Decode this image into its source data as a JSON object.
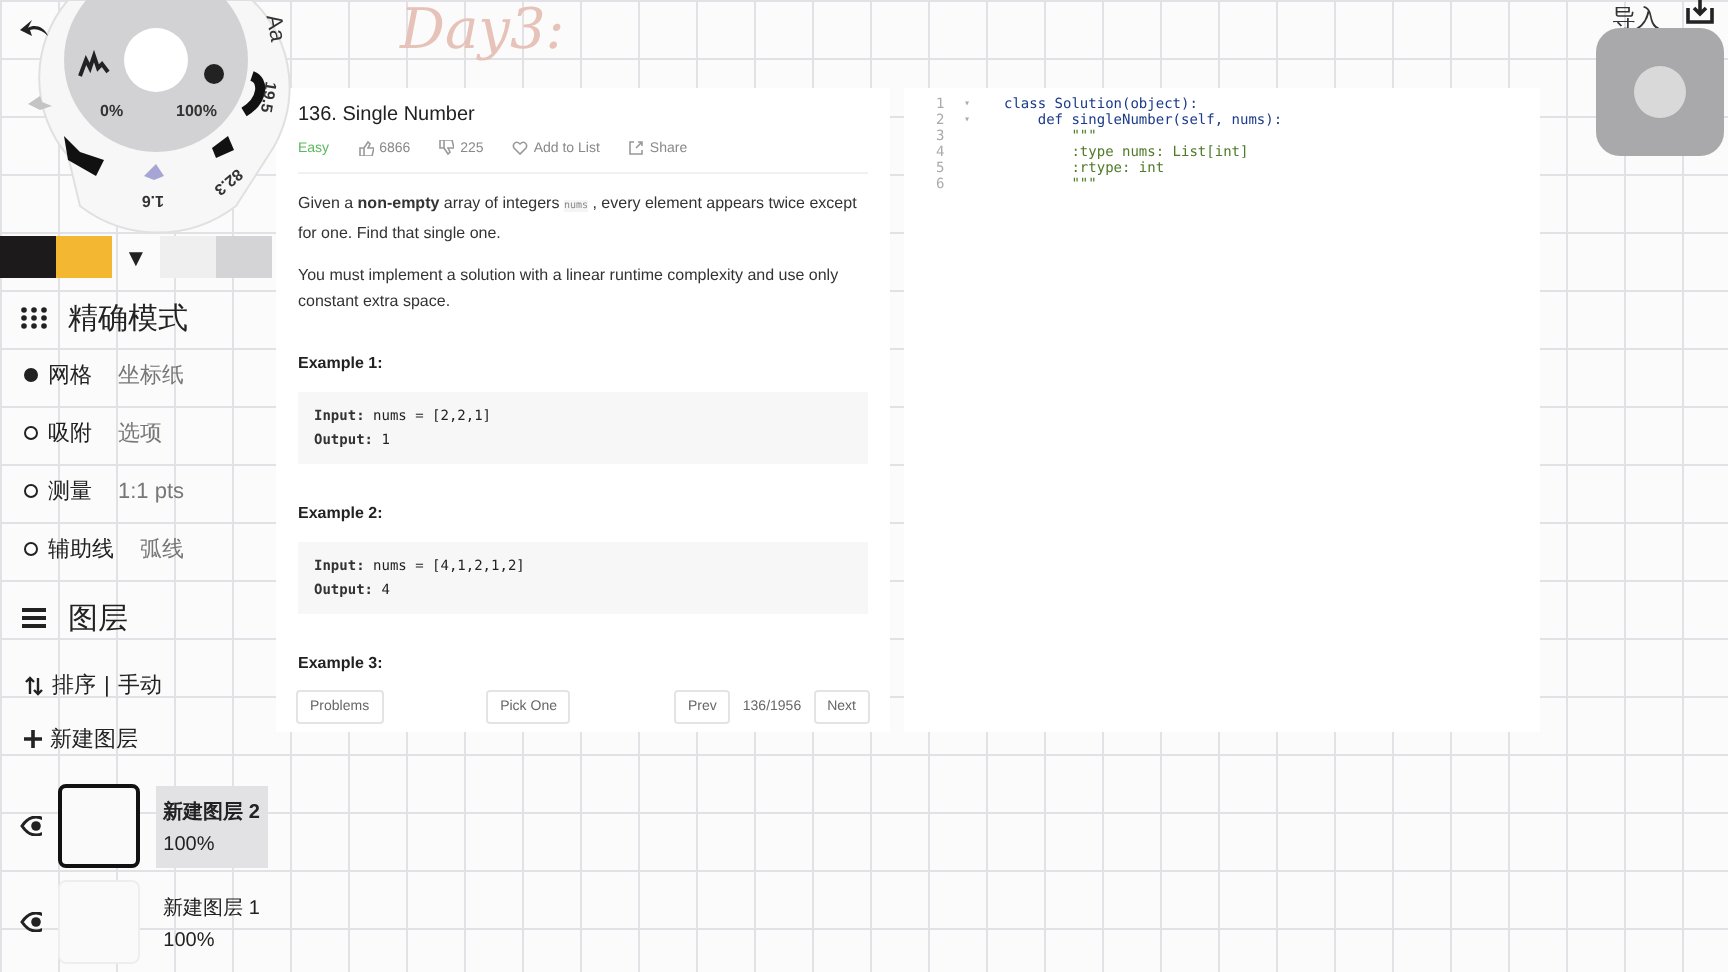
{
  "canvas": {
    "handwriting": "Day3:",
    "import_label": "导入"
  },
  "tool_wheel": {
    "opacity": "0%",
    "size": "100%",
    "text_tool": "Aa",
    "values": [
      "19.5",
      "82.3",
      "1.6"
    ]
  },
  "palette": {
    "caret": "▼",
    "swatches": [
      {
        "color": "#1c1a1a"
      },
      {
        "color": "#f4b731"
      },
      {
        "color": "#efefef"
      },
      {
        "color": "#d4d4d6"
      }
    ]
  },
  "precision": {
    "title": "精确模式",
    "options": [
      {
        "label": "网格",
        "value": "坐标纸",
        "selected": true
      },
      {
        "label": "吸附",
        "value": "选项",
        "selected": false
      },
      {
        "label": "测量",
        "value": "1:1 pts",
        "selected": false
      },
      {
        "label": "辅助线",
        "value": "弧线",
        "selected": false
      }
    ]
  },
  "layers": {
    "title": "图层",
    "sort_label": "排序",
    "sort_separator": "|",
    "sort_value": "手动",
    "new_layer": "新建图层",
    "items": [
      {
        "name": "新建图层 2",
        "opacity": "100%",
        "selected": true
      },
      {
        "name": "新建图层 1",
        "opacity": "100%",
        "selected": false
      }
    ]
  },
  "problem": {
    "title": "136. Single Number",
    "difficulty": "Easy",
    "likes": "6866",
    "dislikes": "225",
    "add_to_list": "Add to List",
    "share": "Share",
    "paragraphs": [
      {
        "before": "Given a **non-empty** array of integers",
        "code": "nums",
        "after": ", every element appears twice except for one. Find that single one."
      },
      {
        "before": "You must implement a solution with a linear runtime complexity and use only constant extra space."
      }
    ],
    "examples": [
      {
        "heading": "Example 1:",
        "input_label": "Input:",
        "input": "nums = [2,2,1]",
        "output_label": "Output:",
        "output": "1"
      },
      {
        "heading": "Example 2:",
        "input_label": "Input:",
        "input": "nums = [4,1,2,1,2]",
        "output_label": "Output:",
        "output": "4"
      },
      {
        "heading": "Example 3:"
      }
    ],
    "footer": {
      "problems": "Problems",
      "pick_one": "Pick One",
      "prev": "Prev",
      "page": "136/1956",
      "next": "Next"
    }
  },
  "code": {
    "fold_marker": "▾",
    "lines": [
      {
        "number": "1",
        "fold": true,
        "kind": "code",
        "text": "class Solution(object):"
      },
      {
        "number": "2",
        "fold": true,
        "kind": "code",
        "text": "    def singleNumber(self, nums):"
      },
      {
        "number": "3",
        "fold": false,
        "kind": "doc",
        "text": "        \"\"\""
      },
      {
        "number": "4",
        "fold": false,
        "kind": "doc",
        "text": "        :type nums: List[int]"
      },
      {
        "number": "5",
        "fold": false,
        "kind": "doc",
        "text": "        :rtype: int"
      },
      {
        "number": "6",
        "fold": false,
        "kind": "doc",
        "text": "        \"\"\""
      }
    ]
  }
}
